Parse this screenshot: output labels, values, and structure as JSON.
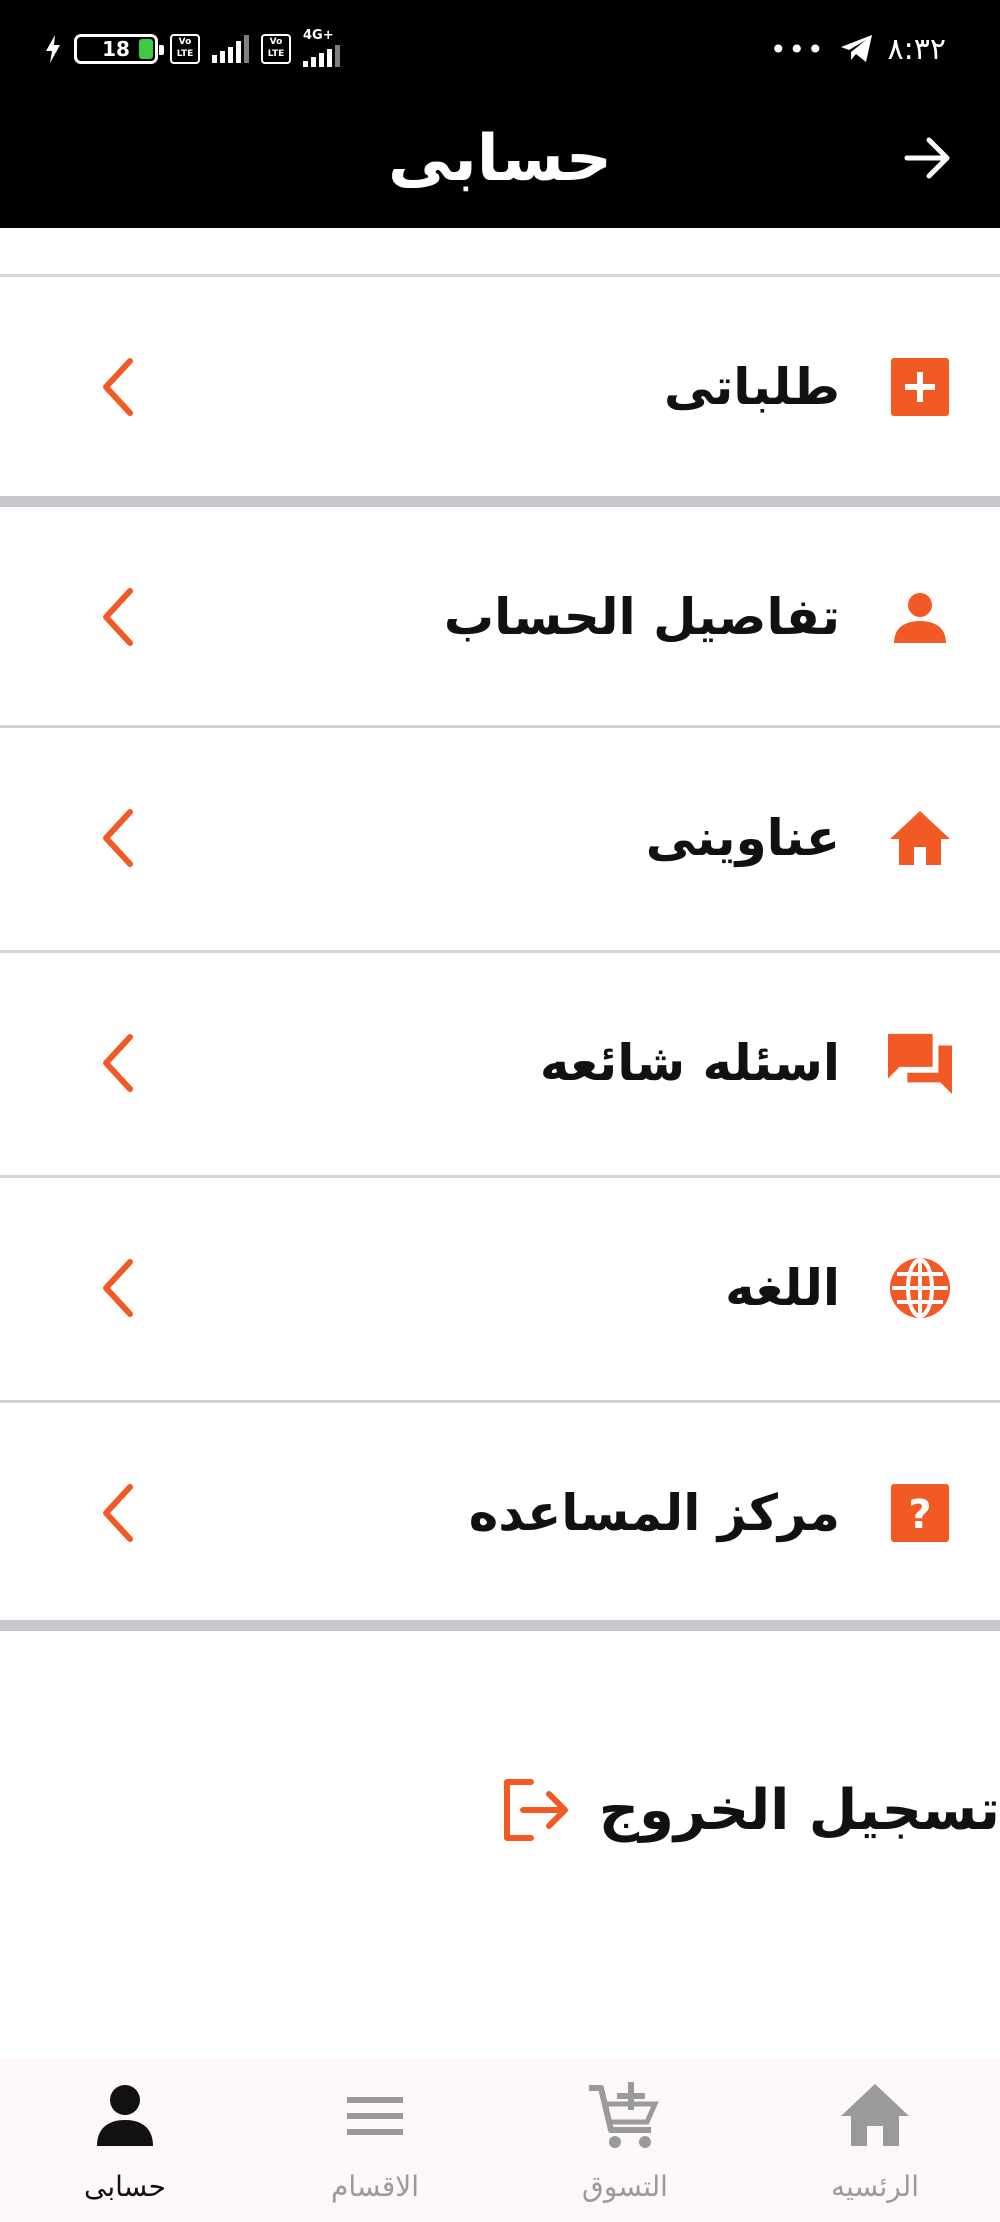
{
  "status_bar": {
    "battery": "18",
    "volte_label": "Vo LTE",
    "network_label": "4G+",
    "overflow": "•••",
    "time": "٨:٣٢"
  },
  "header": {
    "title": "حسابى",
    "back_icon": "arrow-right-icon"
  },
  "accent_color": "#f15a24",
  "menu": [
    {
      "label": "طلباتى",
      "icon": "plus-box-icon"
    },
    {
      "label": "تفاصيل الحساب",
      "icon": "person-icon"
    },
    {
      "label": "عناوينى",
      "icon": "home-icon"
    },
    {
      "label": "اسئله شائعه",
      "icon": "chat-icon"
    },
    {
      "label": "اللغه",
      "icon": "globe-icon"
    },
    {
      "label": "مركز المساعده",
      "icon": "help-box-icon"
    }
  ],
  "logout": {
    "label": "تسجيل الخروج",
    "icon": "logout-icon"
  },
  "bottom_nav": [
    {
      "label": "حسابى",
      "icon": "person-icon",
      "active": true
    },
    {
      "label": "الاقسام",
      "icon": "menu-lines-icon",
      "active": false
    },
    {
      "label": "التسوق",
      "icon": "cart-plus-icon",
      "active": false
    },
    {
      "label": "الرئسيه",
      "icon": "home-icon",
      "active": false
    }
  ]
}
